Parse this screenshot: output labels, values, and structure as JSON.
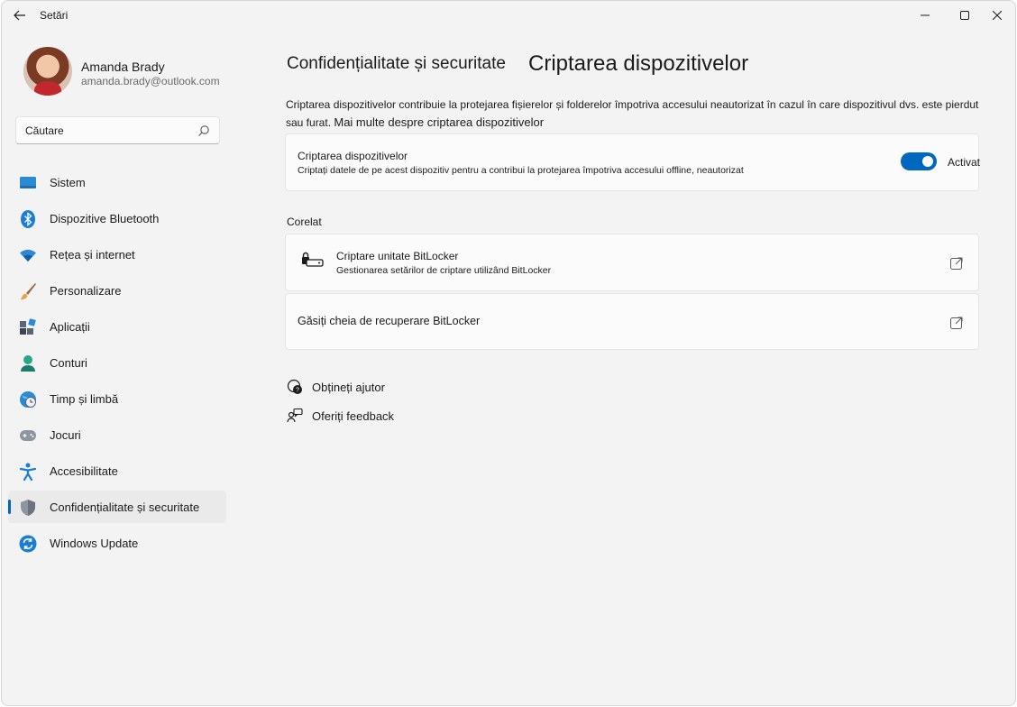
{
  "window": {
    "title": "Setări",
    "back_icon": "arrow-left-icon",
    "controls": [
      "minimize-icon",
      "maximize-icon",
      "close-icon"
    ]
  },
  "profile": {
    "name": "Amanda Brady",
    "email": "amanda.brady@outlook.com"
  },
  "search": {
    "placeholder": "Căutare",
    "icon": "search-icon"
  },
  "sidebar": {
    "items": [
      {
        "label": "Sistem",
        "icon": "system-monitor-icon"
      },
      {
        "label": "Dispozitive Bluetooth",
        "icon": "bluetooth-icon"
      },
      {
        "label": "Rețea și internet",
        "icon": "wifi-icon"
      },
      {
        "label": "Personalizare",
        "icon": "brush-icon"
      },
      {
        "label": "Aplicații",
        "icon": "apps-icon"
      },
      {
        "label": "Conturi",
        "icon": "person-icon"
      },
      {
        "label": "Timp și limbă",
        "icon": "globe-clock-icon"
      },
      {
        "label": "Jocuri",
        "icon": "gamepad-icon"
      },
      {
        "label": "Accesibilitate",
        "icon": "accessibility-icon"
      },
      {
        "label": "Confidențialitate și securitate",
        "icon": "shield-icon",
        "active": true
      },
      {
        "label": "Windows Update",
        "icon": "update-icon"
      }
    ]
  },
  "main": {
    "breadcrumb_parent": "Confidențialitate și securitate",
    "title": "Criptarea dispozitivelor",
    "description": "Criptarea dispozitivelor contribuie la protejarea fișierelor și folderelor împotriva accesului neautorizat în cazul în care dispozitivul dvs. este pierdut sau furat.",
    "description_link": "Mai multe despre criptarea dispozitivelor",
    "encryption_card": {
      "title": "Criptarea dispozitivelor",
      "subtitle": "Criptați datele de pe acest dispozitiv pentru a contribui la protejarea împotriva accesului offline, neautorizat",
      "toggle_state": "Activat",
      "toggle_on": true
    },
    "related_label": "Corelat",
    "bitlocker_card": {
      "title": "Criptare unitate BitLocker",
      "subtitle": "Gestionarea setărilor de criptare utilizând BitLocker",
      "icon": "drive-lock-icon"
    },
    "recovery_card": {
      "title": "Găsiți cheia de recuperare BitLocker"
    },
    "help_links": [
      {
        "label": "Obțineți ajutor",
        "icon": "help-chat-icon"
      },
      {
        "label": "Oferiți feedback",
        "icon": "feedback-icon"
      }
    ]
  },
  "colors": {
    "accent": "#0067c0",
    "window_bg": "#f3f3f3",
    "card_bg": "#fbfbfb"
  }
}
